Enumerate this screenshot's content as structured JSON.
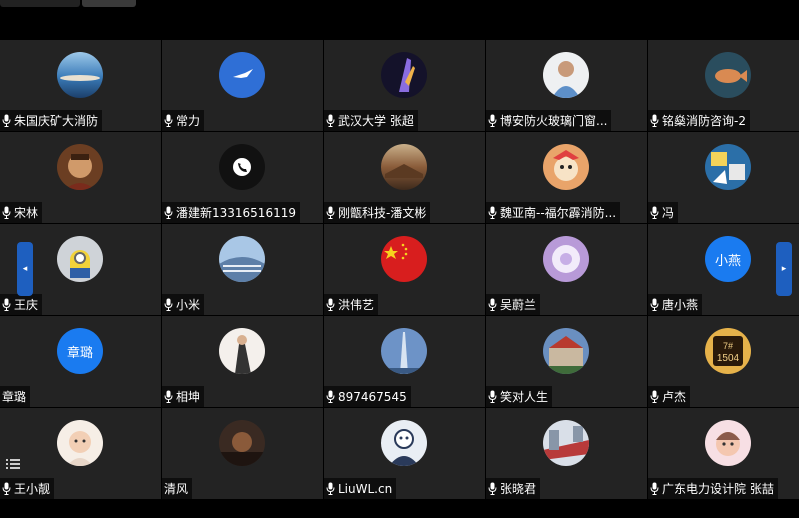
{
  "pager": {
    "prev_icon": "chevron-left-icon",
    "prev_glyph": "◂",
    "next_icon": "chevron-right-icon",
    "next_glyph": "▸"
  },
  "participants": [
    {
      "name": "朱国庆矿大消防",
      "avatar": "lake",
      "mic": true
    },
    {
      "name": "常力",
      "avatar": "bird",
      "mic": true
    },
    {
      "name": "武汉大学 张超",
      "avatar": "purple",
      "mic": true
    },
    {
      "name": "博安防火玻璃门窗...",
      "avatar": "man-white",
      "mic": true
    },
    {
      "name": "铭燊消防咨询-2",
      "avatar": "fish",
      "mic": true
    },
    {
      "name": "宋林",
      "avatar": "face-brown",
      "mic": true
    },
    {
      "name": "潘建新13316516119",
      "avatar": "phone",
      "mic": true
    },
    {
      "name": "刚甑科技-潘文彬",
      "avatar": "wall",
      "mic": true
    },
    {
      "name": "魏亚南--福尔霹消防...",
      "avatar": "cartoon",
      "mic": true
    },
    {
      "name": "冯",
      "avatar": "comic",
      "mic": true
    },
    {
      "name": "王庆",
      "avatar": "minion",
      "mic": true
    },
    {
      "name": "小米",
      "avatar": "building",
      "mic": true
    },
    {
      "name": "洪伟艺",
      "avatar": "flag",
      "mic": true
    },
    {
      "name": "吴蔚兰",
      "avatar": "lilac",
      "mic": true
    },
    {
      "name": "唐小燕",
      "avatar": "text",
      "avatar_text": "小燕",
      "mic": true
    },
    {
      "name": "章璐",
      "avatar": "text",
      "avatar_text": "章璐",
      "mic": false
    },
    {
      "name": "相坤",
      "avatar": "bride",
      "mic": true
    },
    {
      "name": "897467545",
      "avatar": "tower",
      "mic": true
    },
    {
      "name": "笑对人生",
      "avatar": "castle",
      "mic": true
    },
    {
      "name": "卢杰",
      "avatar": "badge",
      "mic": true
    },
    {
      "name": "王小靓",
      "avatar": "baby",
      "mic": true
    },
    {
      "name": "清风",
      "avatar": "dim",
      "mic": false
    },
    {
      "name": "LiuWL.cn",
      "avatar": "sketch",
      "mic": true
    },
    {
      "name": "张晓君",
      "avatar": "street",
      "mic": true
    },
    {
      "name": "广东电力设计院 张喆",
      "avatar": "baby2",
      "mic": true
    }
  ],
  "colors": {
    "tile": "#232323",
    "pager": "#1e5fbf",
    "text_avatar": "#1a7bf0"
  }
}
